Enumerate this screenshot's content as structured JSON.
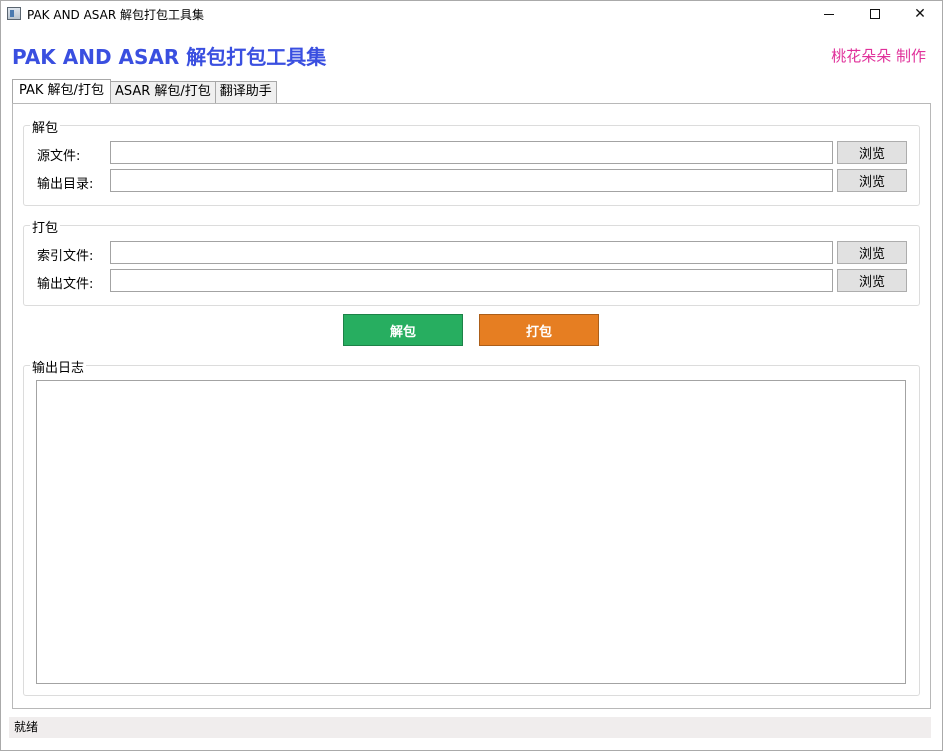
{
  "window": {
    "title": "PAK AND ASAR 解包打包工具集",
    "minimize_icon": "minimize-icon",
    "maximize_icon": "maximize-icon",
    "close_icon": "close-icon"
  },
  "header": {
    "heading": "PAK AND ASAR 解包打包工具集",
    "heading_color": "#3a4fe0",
    "credit": "桃花朵朵 制作",
    "credit_color": "#e0309a"
  },
  "tabs": [
    {
      "label": "PAK 解包/打包",
      "active": true
    },
    {
      "label": "ASAR 解包/打包",
      "active": false
    },
    {
      "label": "翻译助手",
      "active": false
    }
  ],
  "unpack_group": {
    "title": "解包",
    "source_label": "源文件:",
    "source_value": "",
    "output_dir_label": "输出目录:",
    "output_dir_value": "",
    "browse_label": "浏览"
  },
  "pack_group": {
    "title": "打包",
    "index_label": "索引文件:",
    "index_value": "",
    "output_file_label": "输出文件:",
    "output_file_value": "",
    "browse_label": "浏览"
  },
  "actions": {
    "unpack_label": "解包",
    "unpack_color": "#27ae60",
    "pack_label": "打包",
    "pack_color": "#e67e22"
  },
  "log": {
    "title": "输出日志",
    "content": ""
  },
  "status": {
    "text": "就绪"
  }
}
